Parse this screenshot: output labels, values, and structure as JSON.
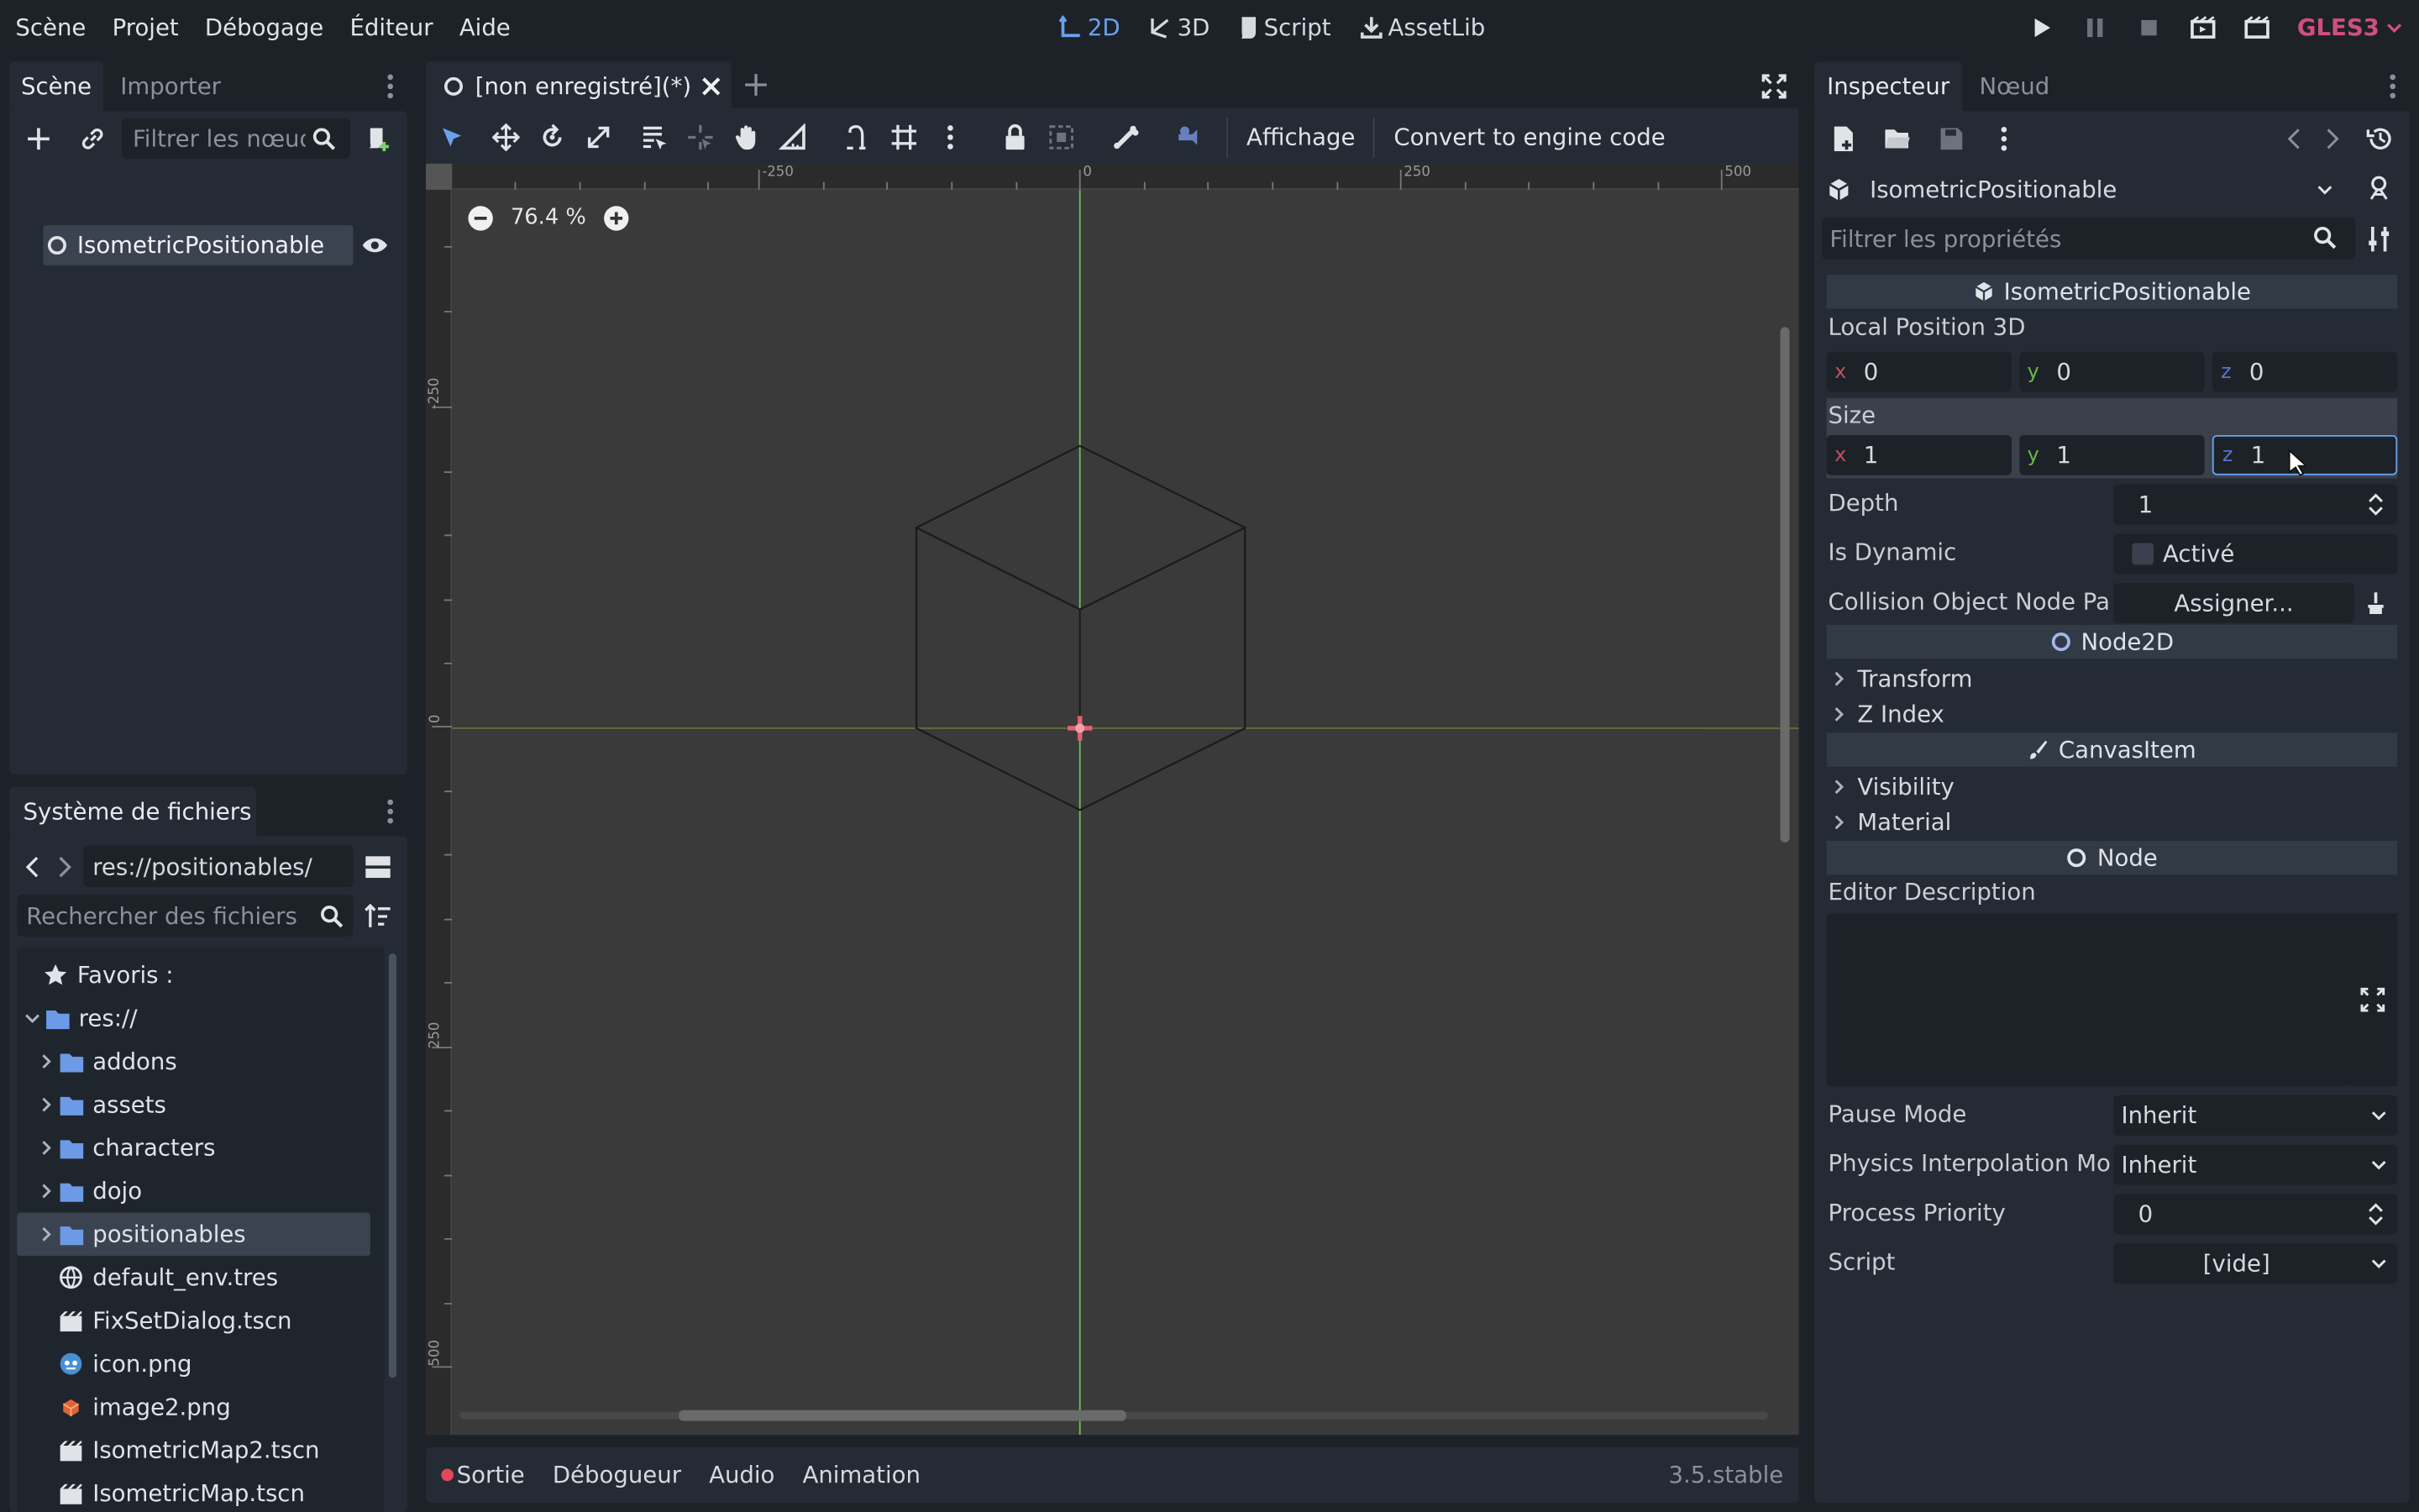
{
  "menu": [
    "Scène",
    "Projet",
    "Débogage",
    "Éditeur",
    "Aide"
  ],
  "workspaces": [
    {
      "label": "2D",
      "icon": "2d-icon",
      "active": true
    },
    {
      "label": "3D",
      "icon": "3d-icon",
      "active": false
    },
    {
      "label": "Script",
      "icon": "script-icon",
      "active": false
    },
    {
      "label": "AssetLib",
      "icon": "assetlib-icon",
      "active": false
    }
  ],
  "renderer": "GLES3",
  "scene_dock": {
    "tabs": [
      "Scène",
      "Importer"
    ],
    "filter_placeholder": "Filtrer les nœuds",
    "root_node": "IsometricPositionable"
  },
  "filesystem_dock": {
    "title": "Système de fichiers",
    "path": "res://positionables/",
    "search_placeholder": "Rechercher des fichiers",
    "favorites": "Favoris :",
    "root": "res://",
    "items": [
      {
        "name": "addons",
        "type": "folder"
      },
      {
        "name": "assets",
        "type": "folder"
      },
      {
        "name": "characters",
        "type": "folder"
      },
      {
        "name": "dojo",
        "type": "folder"
      },
      {
        "name": "positionables",
        "type": "folder",
        "selected": true
      },
      {
        "name": "default_env.tres",
        "type": "env"
      },
      {
        "name": "FixSetDialog.tscn",
        "type": "scene"
      },
      {
        "name": "icon.png",
        "type": "image"
      },
      {
        "name": "image2.png",
        "type": "image2"
      },
      {
        "name": "IsometricMap2.tscn",
        "type": "scene"
      },
      {
        "name": "IsometricMap.tscn",
        "type": "scene"
      }
    ]
  },
  "editor": {
    "tab_title": "[non enregistré](*)",
    "view_menu": "Affichage",
    "convert_button": "Convert to engine code",
    "zoom": "76.4 %",
    "ruler_h": [
      "-250",
      "0",
      "250",
      "500"
    ],
    "ruler_v": [
      "-250",
      "0",
      "250",
      "500"
    ]
  },
  "bottom_panel": {
    "tabs": [
      "Sortie",
      "Débogueur",
      "Audio",
      "Animation"
    ],
    "version": "3.5.stable"
  },
  "inspector": {
    "tabs": [
      "Inspecteur",
      "Nœud"
    ],
    "object_name": "IsometricPositionable",
    "filter_placeholder": "Filtrer les propriétés",
    "class_header": "IsometricPositionable",
    "local_position_label": "Local Position 3D",
    "local_position": {
      "x": "0",
      "y": "0",
      "z": "0"
    },
    "size_label": "Size",
    "size": {
      "x": "1",
      "y": "1",
      "z": "1"
    },
    "depth_label": "Depth",
    "depth": "1",
    "is_dynamic_label": "Is Dynamic",
    "is_dynamic_value": "Activé",
    "collision_label": "Collision Object Node Pa",
    "collision_value": "Assigner...",
    "node2d_header": "Node2D",
    "node2d_sections": [
      "Transform",
      "Z Index"
    ],
    "canvas_header": "CanvasItem",
    "canvas_sections": [
      "Visibility",
      "Material"
    ],
    "node_header": "Node",
    "editor_description_label": "Editor Description",
    "pause_mode_label": "Pause Mode",
    "pause_mode": "Inherit",
    "physics_label": "Physics Interpolation Mo",
    "physics_value": "Inherit",
    "priority_label": "Process Priority",
    "priority": "0",
    "script_label": "Script",
    "script_value": "[vide]"
  },
  "colors": {
    "accent": "#6aa2ec",
    "renderer": "#d04f7c",
    "axis_x": "#c0505a",
    "axis_y": "#68b84c",
    "axis_z": "#5674c8"
  }
}
